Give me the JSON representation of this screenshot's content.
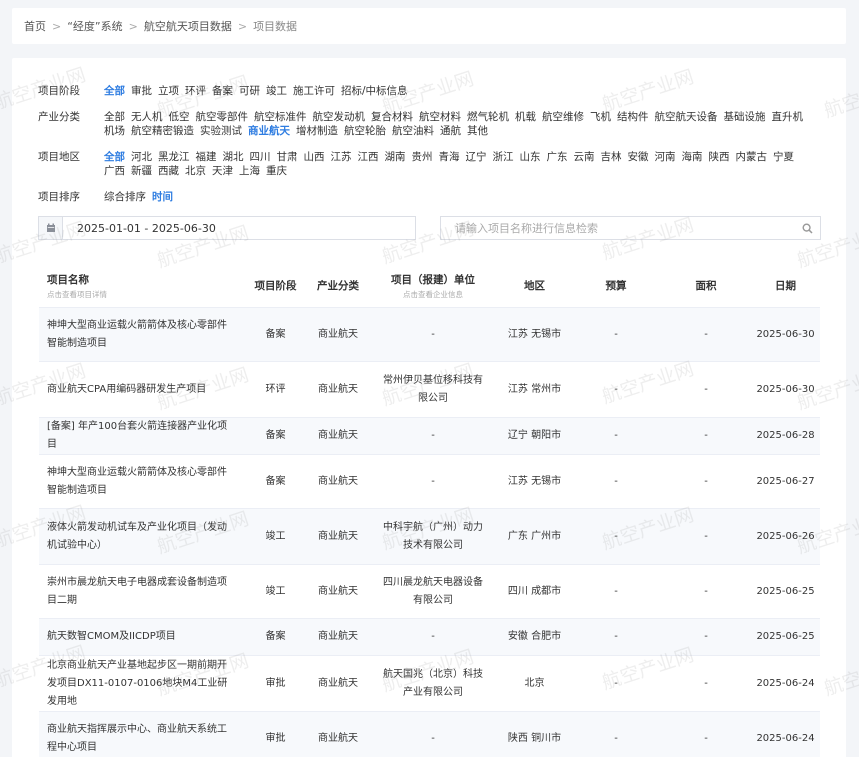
{
  "breadcrumb": [
    "首页",
    "“经度”系统",
    "航空航天项目数据",
    "项目数据"
  ],
  "filters": {
    "stage": {
      "label": "项目阶段",
      "options": [
        "全部",
        "审批",
        "立项",
        "环评",
        "备案",
        "可研",
        "竣工",
        "施工许可",
        "招标/中标信息"
      ],
      "active": 0
    },
    "industry": {
      "label": "产业分类",
      "options": [
        "全部",
        "无人机",
        "低空",
        "航空零部件",
        "航空标准件",
        "航空发动机",
        "复合材料",
        "航空材料",
        "燃气轮机",
        "机载",
        "航空维修",
        "飞机",
        "结构件",
        "航空航天设备",
        "基础设施",
        "直升机",
        "机场",
        "航空精密锻造",
        "实验测试",
        "商业航天",
        "增材制造",
        "航空轮胎",
        "航空油料",
        "通航",
        "其他"
      ],
      "active": 19
    },
    "region": {
      "label": "项目地区",
      "options": [
        "全部",
        "河北",
        "黑龙江",
        "福建",
        "湖北",
        "四川",
        "甘肃",
        "山西",
        "江苏",
        "江西",
        "湖南",
        "贵州",
        "青海",
        "辽宁",
        "浙江",
        "山东",
        "广东",
        "云南",
        "吉林",
        "安徽",
        "河南",
        "海南",
        "陕西",
        "内蒙古",
        "宁夏",
        "广西",
        "新疆",
        "西藏",
        "北京",
        "天津",
        "上海",
        "重庆"
      ],
      "active": 0
    },
    "sort": {
      "label": "项目排序",
      "options": [
        "综合排序",
        "时间"
      ],
      "active": 1
    }
  },
  "date_range": "2025-01-01 - 2025-06-30",
  "search": {
    "placeholder": "请输入项目名称进行信息检索",
    "value": ""
  },
  "table": {
    "headers": {
      "name": "项目名称",
      "name_sub": "点击查看项目详情",
      "stage": "项目阶段",
      "category": "产业分类",
      "unit": "项目（报建）单位",
      "unit_sub": "点击查看企业信息",
      "region": "地区",
      "budget": "预算",
      "area": "面积",
      "date": "日期"
    },
    "rows": [
      {
        "name": "神坤大型商业运载火箭箭体及核心零部件智能制造项目",
        "stage": "备案",
        "category": "商业航天",
        "unit": "-",
        "region": "江苏 无锡市",
        "budget": "-",
        "area": "-",
        "date": "2025-06-30"
      },
      {
        "name": "商业航天CPA用编码器研发生产项目",
        "stage": "环评",
        "category": "商业航天",
        "unit": "常州伊贝基位移科技有限公司",
        "region": "江苏 常州市",
        "budget": "-",
        "area": "-",
        "date": "2025-06-30"
      },
      {
        "name": "[备案] 年产100台套火箭连接器产业化项目",
        "stage": "备案",
        "category": "商业航天",
        "unit": "-",
        "region": "辽宁 朝阳市",
        "budget": "-",
        "area": "-",
        "date": "2025-06-28"
      },
      {
        "name": "神坤大型商业运载火箭箭体及核心零部件智能制造项目",
        "stage": "备案",
        "category": "商业航天",
        "unit": "-",
        "region": "江苏 无锡市",
        "budget": "-",
        "area": "-",
        "date": "2025-06-27"
      },
      {
        "name": "液体火箭发动机试车及产业化项目（发动机试验中心）",
        "stage": "竣工",
        "category": "商业航天",
        "unit": "中科宇航（广州）动力技术有限公司",
        "region": "广东 广州市",
        "budget": "-",
        "area": "-",
        "date": "2025-06-26"
      },
      {
        "name": "崇州市晨龙航天电子电器成套设备制造项目二期",
        "stage": "竣工",
        "category": "商业航天",
        "unit": "四川晨龙航天电器设备有限公司",
        "region": "四川 成都市",
        "budget": "-",
        "area": "-",
        "date": "2025-06-25"
      },
      {
        "name": "航天数智CMOM及IICDP项目",
        "stage": "备案",
        "category": "商业航天",
        "unit": "-",
        "region": "安徽 合肥市",
        "budget": "-",
        "area": "-",
        "date": "2025-06-25"
      },
      {
        "name": "北京商业航天产业基地起步区一期前期开发项目DX11-0107-0106地块M4工业研发用地",
        "stage": "审批",
        "category": "商业航天",
        "unit": "航天国兆（北京）科技产业有限公司",
        "region": "北京",
        "budget": "-",
        "area": "-",
        "date": "2025-06-24"
      },
      {
        "name": "商业航天指挥展示中心、商业航天系统工程中心项目",
        "stage": "审批",
        "category": "商业航天",
        "unit": "-",
        "region": "陕西 铜川市",
        "budget": "-",
        "area": "-",
        "date": "2025-06-24"
      }
    ]
  },
  "watermark": "航空产业网",
  "colors": {
    "accent": "#2f7de1",
    "stripe": "#f7f9fc",
    "border": "#ebeef5"
  }
}
